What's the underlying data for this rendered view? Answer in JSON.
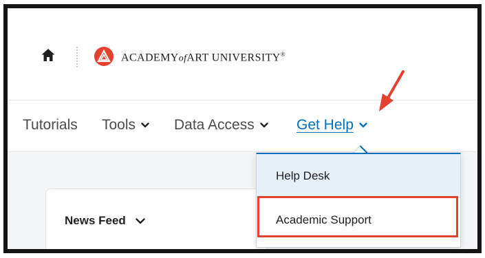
{
  "header": {
    "brand_main": "ACADEMY",
    "brand_of": "of",
    "brand_rest": "ART UNIVERSITY",
    "brand_reg": "®",
    "home_icon": "home-icon",
    "logo_icon": "academy-logo-icon"
  },
  "nav": {
    "items": [
      {
        "label": "Tutorials"
      },
      {
        "label": "Tools"
      },
      {
        "label": "Data Access"
      },
      {
        "label": "Get Help"
      }
    ],
    "active_color": "#006fbf"
  },
  "news_feed": {
    "title": "News Feed"
  },
  "dropdown": {
    "items": [
      {
        "label": "Help Desk"
      },
      {
        "label": "Academic Support"
      }
    ]
  },
  "annotation": {
    "arrow_color": "#e4412f",
    "highlight_color": "#e4412f"
  }
}
